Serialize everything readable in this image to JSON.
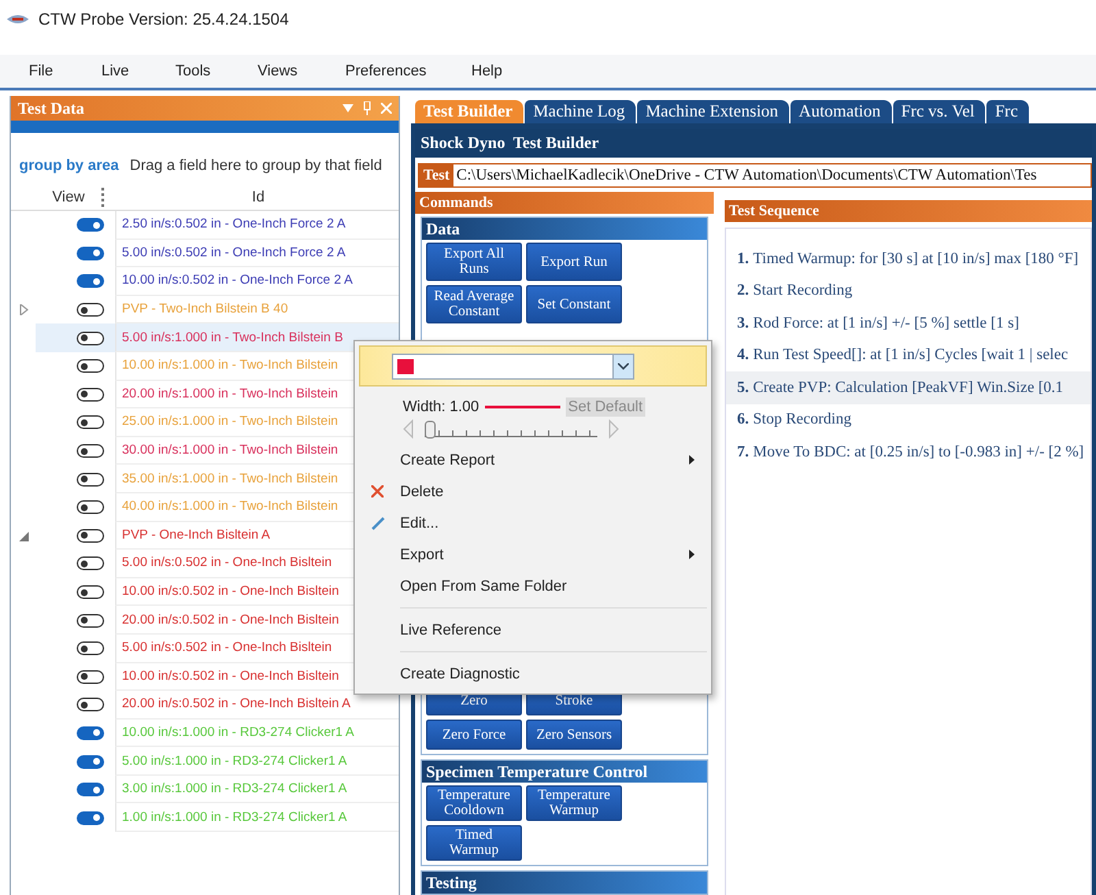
{
  "window": {
    "title": "CTW Probe Version: 25.4.24.1504"
  },
  "menu": [
    "File",
    "Live",
    "Tools",
    "Views",
    "Preferences",
    "Help"
  ],
  "test_data": {
    "title": "Test Data",
    "group_by": "group by area",
    "group_hint": "Drag a field here to group by that field",
    "columns": [
      "View",
      "Id"
    ],
    "rows": [
      {
        "kind": "run",
        "on": true,
        "selected": false,
        "text": "2.50 in/s:0.502 in - One-Inch Force 2 A",
        "color": "#3c3cb4"
      },
      {
        "kind": "run",
        "on": true,
        "selected": false,
        "text": "5.00 in/s:0.502 in - One-Inch Force 2 A",
        "color": "#3c3cb4"
      },
      {
        "kind": "run",
        "on": true,
        "selected": false,
        "text": "10.00 in/s:0.502 in - One-Inch Force 2 A",
        "color": "#3c3cb4"
      },
      {
        "kind": "group",
        "expanded": false,
        "on": false,
        "selected": false,
        "text": "PVP - Two-Inch Bilstein B 40",
        "color": "#e8a23c"
      },
      {
        "kind": "run",
        "on": false,
        "selected": true,
        "text": "5.00 in/s:1.000 in - Two-Inch Bilstein B",
        "color": "#d8305c"
      },
      {
        "kind": "run",
        "on": false,
        "selected": false,
        "text": "10.00 in/s:1.000 in - Two-Inch Bilstein",
        "color": "#e8a23c"
      },
      {
        "kind": "run",
        "on": false,
        "selected": false,
        "text": "20.00 in/s:1.000 in - Two-Inch Bilstein",
        "color": "#d8305c"
      },
      {
        "kind": "run",
        "on": false,
        "selected": false,
        "text": "25.00 in/s:1.000 in - Two-Inch Bilstein",
        "color": "#e8a23c"
      },
      {
        "kind": "run",
        "on": false,
        "selected": false,
        "text": "30.00 in/s:1.000 in - Two-Inch Bilstein",
        "color": "#d8305c"
      },
      {
        "kind": "run",
        "on": false,
        "selected": false,
        "text": "35.00 in/s:1.000 in - Two-Inch Bilstein",
        "color": "#e8a23c"
      },
      {
        "kind": "run",
        "on": false,
        "selected": false,
        "text": "40.00 in/s:1.000 in - Two-Inch Bilstein",
        "color": "#e8a23c"
      },
      {
        "kind": "group",
        "expanded": true,
        "on": false,
        "selected": false,
        "text": "PVP - One-Inch Bisltein A",
        "color": "#d83030"
      },
      {
        "kind": "run",
        "on": false,
        "selected": false,
        "text": "5.00 in/s:0.502 in - One-Inch Bisltein",
        "color": "#d83030"
      },
      {
        "kind": "run",
        "on": false,
        "selected": false,
        "text": "10.00 in/s:0.502 in - One-Inch Bisltein",
        "color": "#d83030"
      },
      {
        "kind": "run",
        "on": false,
        "selected": false,
        "text": "20.00 in/s:0.502 in - One-Inch Bisltein",
        "color": "#d83030"
      },
      {
        "kind": "run",
        "on": false,
        "selected": false,
        "text": "5.00 in/s:0.502 in - One-Inch Bisltein",
        "color": "#d83030"
      },
      {
        "kind": "run",
        "on": false,
        "selected": false,
        "text": "10.00 in/s:0.502 in - One-Inch Bisltein",
        "color": "#d83030"
      },
      {
        "kind": "run",
        "on": false,
        "selected": false,
        "text": "20.00 in/s:0.502 in - One-Inch Bisltein A",
        "color": "#d83030"
      },
      {
        "kind": "run",
        "on": true,
        "selected": false,
        "text": "10.00 in/s:1.000 in - RD3-274 Clicker1 A",
        "color": "#58c83c"
      },
      {
        "kind": "run",
        "on": true,
        "selected": false,
        "text": "5.00 in/s:1.000 in - RD3-274 Clicker1 A",
        "color": "#58c83c"
      },
      {
        "kind": "run",
        "on": true,
        "selected": false,
        "text": "3.00 in/s:1.000 in - RD3-274 Clicker1 A",
        "color": "#58c83c"
      },
      {
        "kind": "run",
        "on": true,
        "selected": false,
        "text": "1.00 in/s:1.000 in - RD3-274 Clicker1 A",
        "color": "#58c83c"
      }
    ]
  },
  "tabs": [
    {
      "label": "Test Builder",
      "selected": true
    },
    {
      "label": "Machine Log",
      "selected": false
    },
    {
      "label": "Machine Extension",
      "selected": false
    },
    {
      "label": "Automation",
      "selected": false
    },
    {
      "label": "Frc vs. Vel",
      "selected": false
    },
    {
      "label": "Frc",
      "selected": false
    }
  ],
  "builder": {
    "title": "Shock Dyno  Test Builder",
    "test_label": "Test",
    "test_path": "C:\\Users\\MichaelKadlecik\\OneDrive - CTW Automation\\Documents\\CTW Automation\\Tes",
    "commands_title": "Commands",
    "groups": [
      {
        "title": "Data",
        "buttons": [
          "Export All Runs",
          "Export Run",
          "Read Average Constant",
          "Set Constant"
        ],
        "more_buttons": [
          "Zero",
          "Stroke",
          "Zero Force",
          "Zero Sensors"
        ]
      },
      {
        "title": "Specimen Temperature Control",
        "buttons": [
          "Temperature Cooldown",
          "Temperature Warmup",
          "Timed Warmup"
        ]
      },
      {
        "title": "Testing"
      }
    ],
    "sequence_title": "Test Sequence",
    "sequence": [
      {
        "num": "1.",
        "text": "Timed Warmup: for [30 s] at [10 in/s] max [180 °F]",
        "selected": false
      },
      {
        "num": "2.",
        "text": "Start Recording",
        "selected": false
      },
      {
        "num": "3.",
        "text": "Rod Force: at [1 in/s] +/- [5 %] settle [1 s]",
        "selected": false
      },
      {
        "num": "4.",
        "text": "Run Test Speed[]: at [1 in/s] Cycles [wait 1 | selec",
        "selected": false
      },
      {
        "num": "5.",
        "text": "Create PVP: Calculation [PeakVF] Win.Size [0.1",
        "selected": true
      },
      {
        "num": "6.",
        "text": "Stop Recording",
        "selected": false
      },
      {
        "num": "7.",
        "text": "Move To BDC: at [0.25 in/s] to [-0.983 in] +/- [2 %]",
        "selected": false
      }
    ]
  },
  "context_menu": {
    "width_label": "Width: 1.00",
    "set_default": {
      "label": "Set Default",
      "disabled": true
    },
    "width_slider": {
      "level": 0.0
    },
    "items": [
      {
        "kind": "item",
        "label": "Create Report",
        "submenu": true
      },
      {
        "kind": "delete",
        "label": "Delete",
        "submenu": false
      },
      {
        "kind": "edit",
        "label": "Edit...",
        "submenu": false
      },
      {
        "kind": "item",
        "label": "Export",
        "submenu": true
      },
      {
        "kind": "item",
        "label": "Open From Same Folder",
        "submenu": false
      },
      {
        "kind": "separator"
      },
      {
        "kind": "item",
        "label": "Live Reference",
        "submenu": false
      },
      {
        "kind": "separator"
      },
      {
        "kind": "item",
        "label": "Create Diagnostic",
        "submenu": false
      }
    ]
  }
}
